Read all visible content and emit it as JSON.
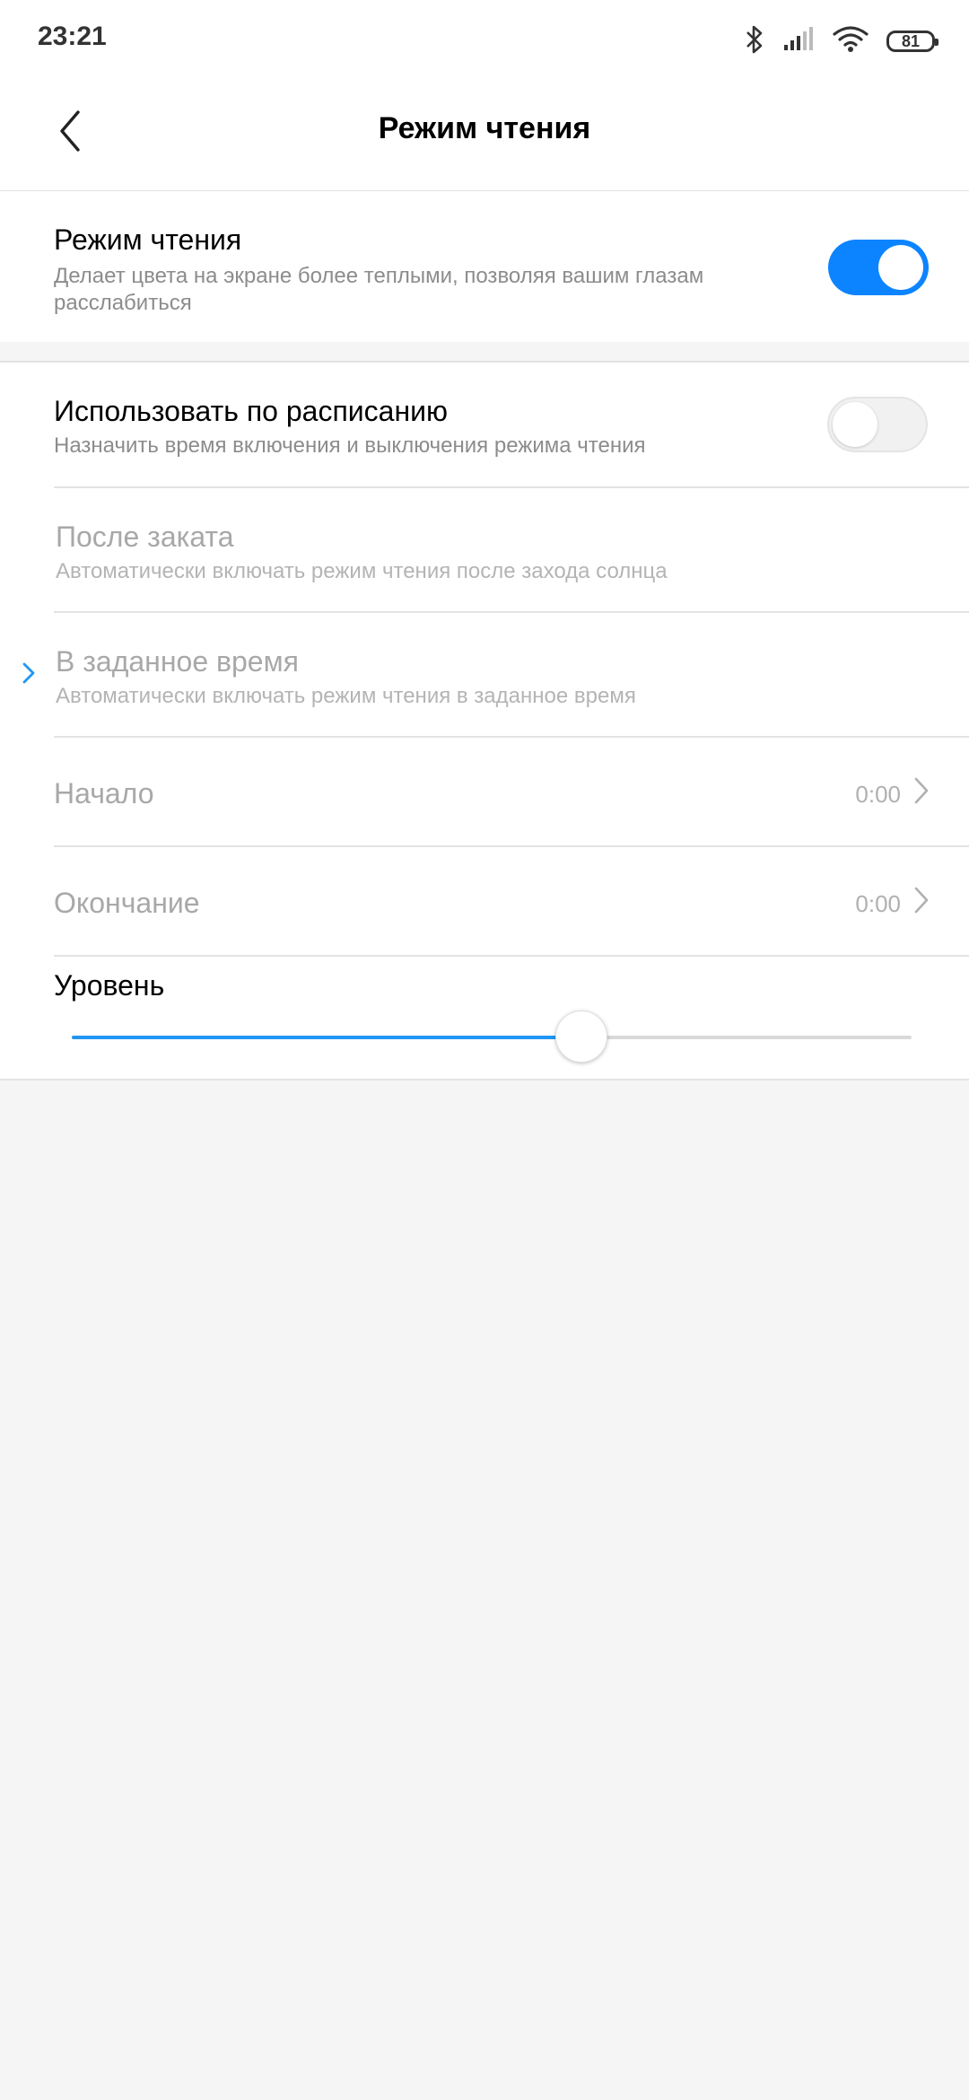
{
  "status_bar": {
    "time": "23:21",
    "battery": "81",
    "icons": [
      "bluetooth-icon",
      "signal-icon",
      "wifi-icon",
      "battery-icon"
    ]
  },
  "header": {
    "title": "Режим чтения",
    "back_icon": "chevron-left-icon"
  },
  "reading_mode": {
    "title": "Режим чтения",
    "subtitle": "Делает цвета на экране более теплыми, позволяя вашим глазам расслабиться",
    "enabled": true
  },
  "schedule": {
    "title": "Использовать по расписанию",
    "subtitle": "Назначить время включения и выключения режима чтения",
    "enabled": false,
    "options": [
      {
        "title": "После заката",
        "subtitle": "Автоматически включать режим чтения после захода солнца",
        "selected": false
      },
      {
        "title": "В заданное время",
        "subtitle": "Автоматически включать режим чтения в заданное время",
        "selected": true
      }
    ],
    "start": {
      "label": "Начало",
      "value": "0:00"
    },
    "end": {
      "label": "Окончание",
      "value": "0:00"
    }
  },
  "level": {
    "label": "Уровень",
    "value_fraction": 0.607
  },
  "colors": {
    "accent": "#0d84ff",
    "slider_fill": "#2196f3",
    "background": "#f5f5f5"
  }
}
